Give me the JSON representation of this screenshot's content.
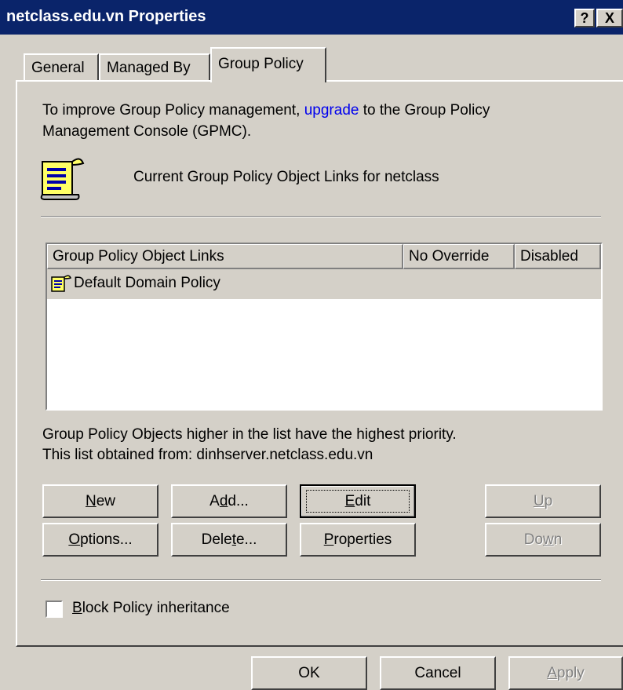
{
  "window": {
    "title": "netclass.edu.vn Properties",
    "help_label": "?",
    "close_label": "X"
  },
  "tabs": [
    {
      "label": "General"
    },
    {
      "label": "Managed By"
    },
    {
      "label": "Group Policy",
      "active": true
    }
  ],
  "group_policy": {
    "intro_pre": "To improve Group Policy management, ",
    "intro_link": "upgrade",
    "intro_post": " to the Group Policy",
    "intro_line2": "Management Console (GPMC).",
    "current_links_label": "Current Group Policy Object Links for netclass",
    "list": {
      "columns": [
        "Group Policy Object Links",
        "No Override",
        "Disabled"
      ],
      "rows": [
        {
          "name": "Default Domain Policy",
          "no_override": "",
          "disabled": ""
        }
      ]
    },
    "priority_note": "Group Policy Objects higher in the list have the highest priority.",
    "obtained_from": "This list obtained from: dinhserver.netclass.edu.vn",
    "buttons": {
      "new": {
        "pre": "",
        "mnemonic": "N",
        "post": "ew"
      },
      "add": {
        "pre": "A",
        "mnemonic": "d",
        "post": "d..."
      },
      "edit": {
        "pre": "",
        "mnemonic": "E",
        "post": "dit"
      },
      "up": {
        "pre": "",
        "mnemonic": "U",
        "post": "p",
        "enabled": false
      },
      "options": {
        "pre": "",
        "mnemonic": "O",
        "post": "ptions...",
        "enabled": true
      },
      "delete": {
        "pre": "Dele",
        "mnemonic": "t",
        "post": "e..."
      },
      "properties": {
        "pre": "",
        "mnemonic": "P",
        "post": "roperties"
      },
      "down": {
        "pre": "Do",
        "mnemonic": "w",
        "post": "n",
        "enabled": false
      }
    },
    "block_inheritance": {
      "pre": "",
      "mnemonic": "B",
      "post": "lock Policy inheritance",
      "checked": false
    }
  },
  "footer": {
    "ok_label": "OK",
    "cancel_label": "Cancel",
    "apply": {
      "pre": "",
      "mnemonic": "A",
      "post": "pply",
      "enabled": false
    }
  },
  "colors": {
    "titlebar": "#0a246a",
    "face": "#d4d0c8",
    "link": "#0000ee",
    "selected_row": "#d4d0c8"
  },
  "icons": {
    "policy_large": "gpo-scroll-icon",
    "policy_row": "gpo-scroll-icon"
  }
}
